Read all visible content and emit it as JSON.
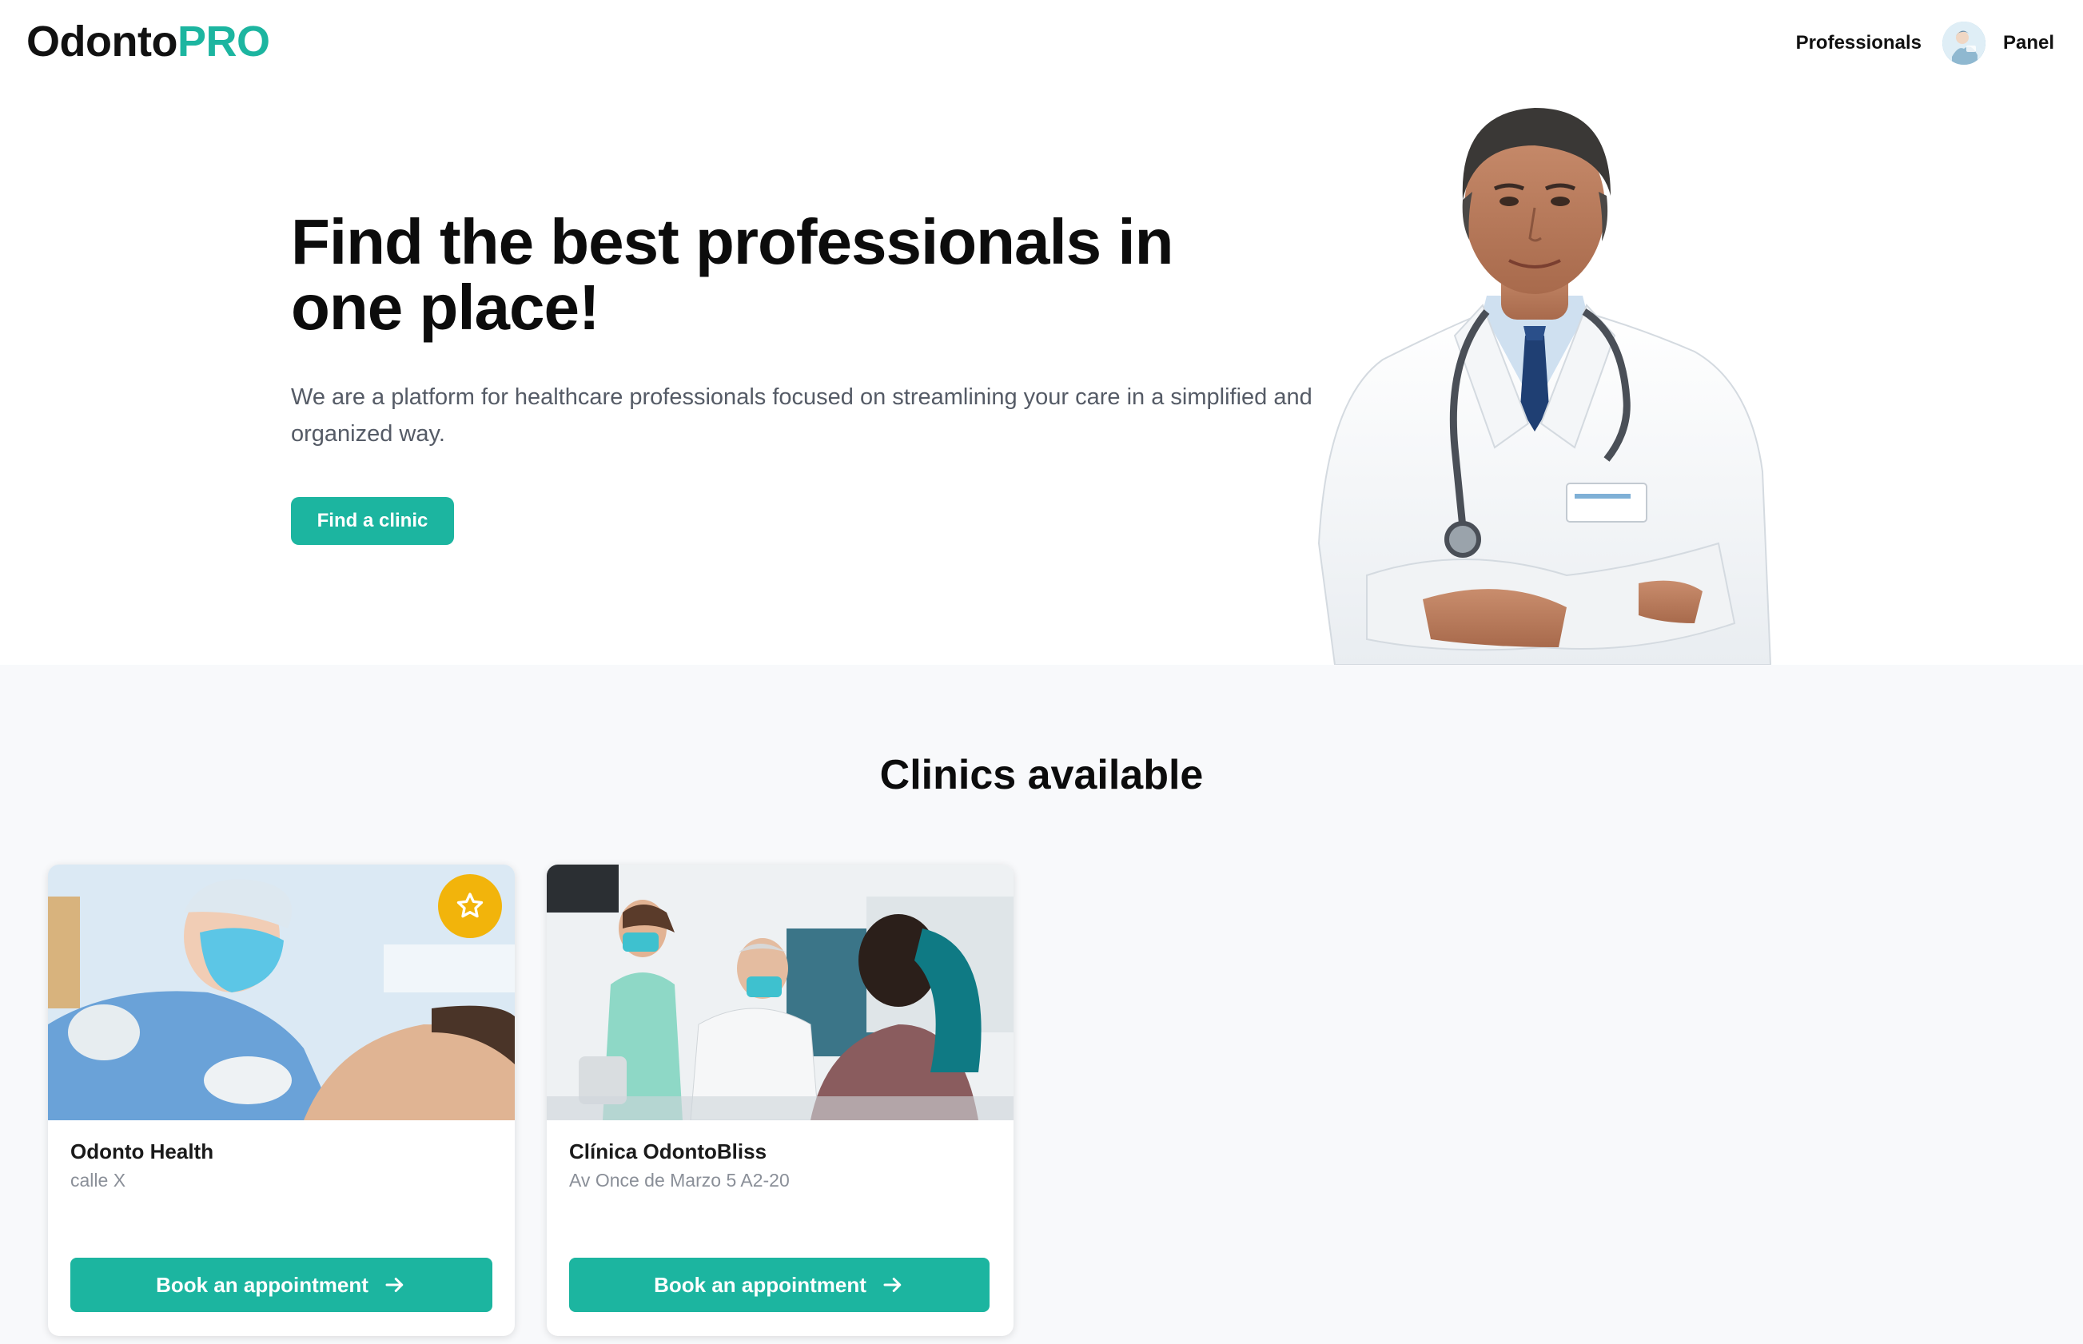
{
  "header": {
    "logo_main": "Odonto",
    "logo_accent": "PRO",
    "nav_professionals": "Professionals",
    "nav_panel": "Panel"
  },
  "hero": {
    "title": "Find the best professionals in one place!",
    "description": "We are a platform for healthcare professionals focused on streamlining your care in a simplified and organized way.",
    "cta_label": "Find a clinic"
  },
  "clinics": {
    "title": "Clinics available",
    "items": [
      {
        "name": "Odonto Health",
        "address": "calle X",
        "button_label": "Book an appointment",
        "favorite": true
      },
      {
        "name": "Clínica OdontoBliss",
        "address": "Av Once de Marzo 5 A2-20",
        "button_label": "Book an appointment",
        "favorite": false
      }
    ]
  },
  "colors": {
    "accent": "#1cb5a0",
    "favorite_badge": "#f2b40b",
    "section_bg": "#f8f9fb",
    "text_muted": "#555b66"
  },
  "icons": {
    "avatar": "user-avatar",
    "favorite": "star-icon",
    "button_arrow": "arrow-right-icon"
  }
}
